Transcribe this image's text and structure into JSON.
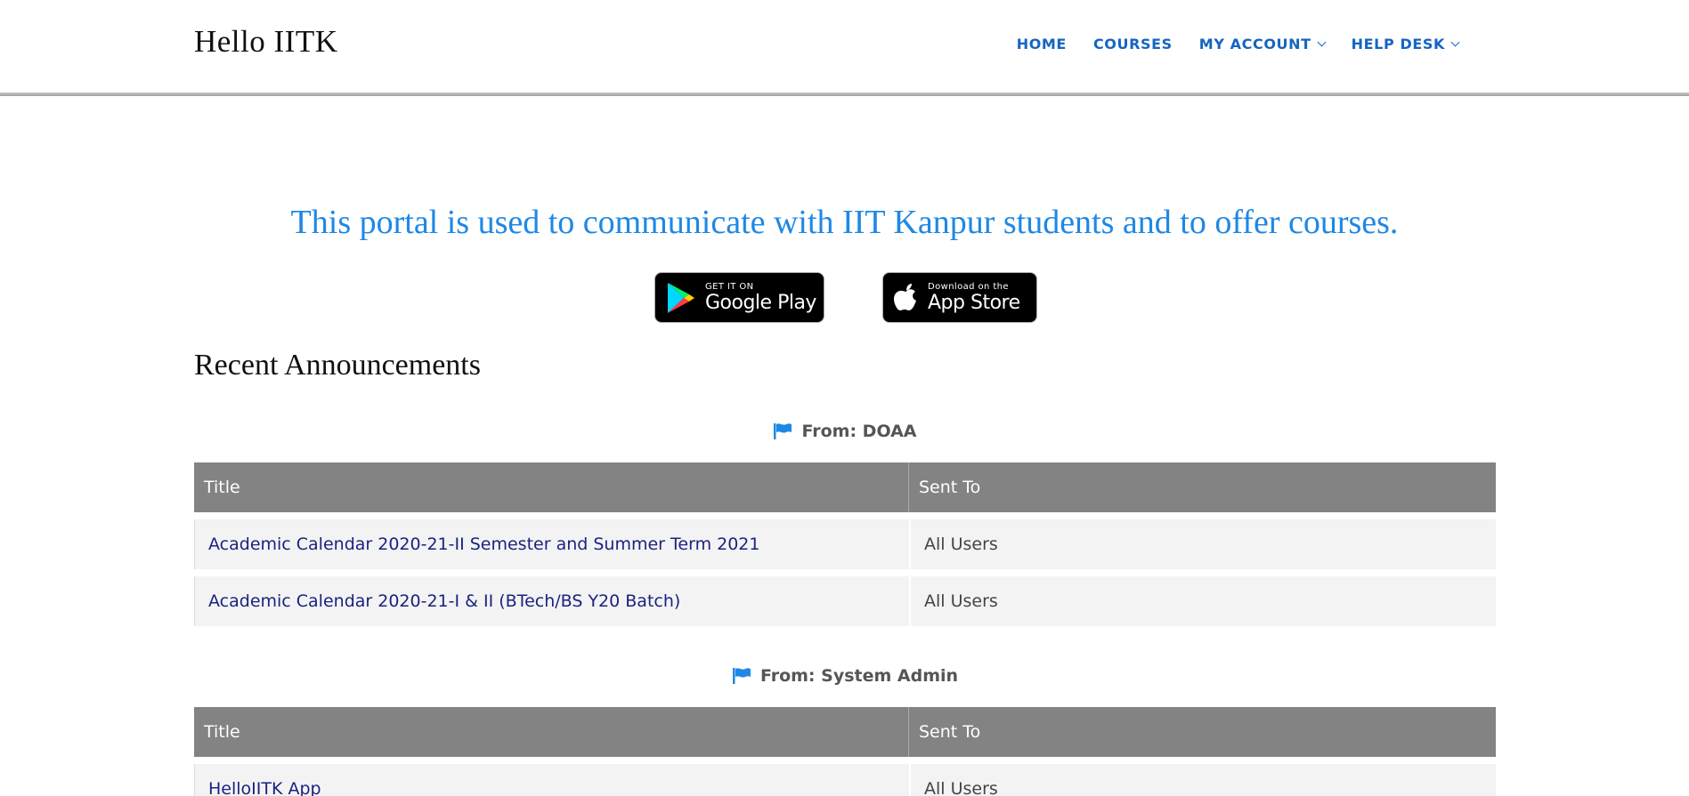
{
  "header": {
    "brand": "Hello IITK",
    "nav": [
      {
        "label": "HOME",
        "dropdown": false
      },
      {
        "label": "COURSES",
        "dropdown": false
      },
      {
        "label": "MY ACCOUNT",
        "dropdown": true
      },
      {
        "label": "HELP DESK",
        "dropdown": true
      }
    ]
  },
  "tagline": "This portal is used to communicate with IIT Kanpur students and to offer courses.",
  "badges": {
    "google_play": {
      "small": "GET IT ON",
      "big": "Google Play"
    },
    "app_store": {
      "small": "Download on the",
      "big": "App Store"
    }
  },
  "announcements": {
    "title": "Recent Announcements",
    "groups": [
      {
        "from": "From: DOAA",
        "columns": [
          "Title",
          "Sent To"
        ],
        "rows": [
          [
            "Academic Calendar 2020-21-II Semester and Summer Term 2021",
            "All Users"
          ],
          [
            "Academic Calendar 2020-21-I & II (BTech/BS Y20 Batch)",
            "All Users"
          ]
        ]
      },
      {
        "from": "From: System Admin",
        "columns": [
          "Title",
          "Sent To"
        ],
        "rows": [
          [
            "HelloIITK App",
            "All Users"
          ]
        ]
      }
    ]
  },
  "colors": {
    "accent": "#1e88e5",
    "nav": "#1565c0",
    "table_header": "#838383",
    "row_bg": "#f4f3f4",
    "link": "#1a237e"
  }
}
